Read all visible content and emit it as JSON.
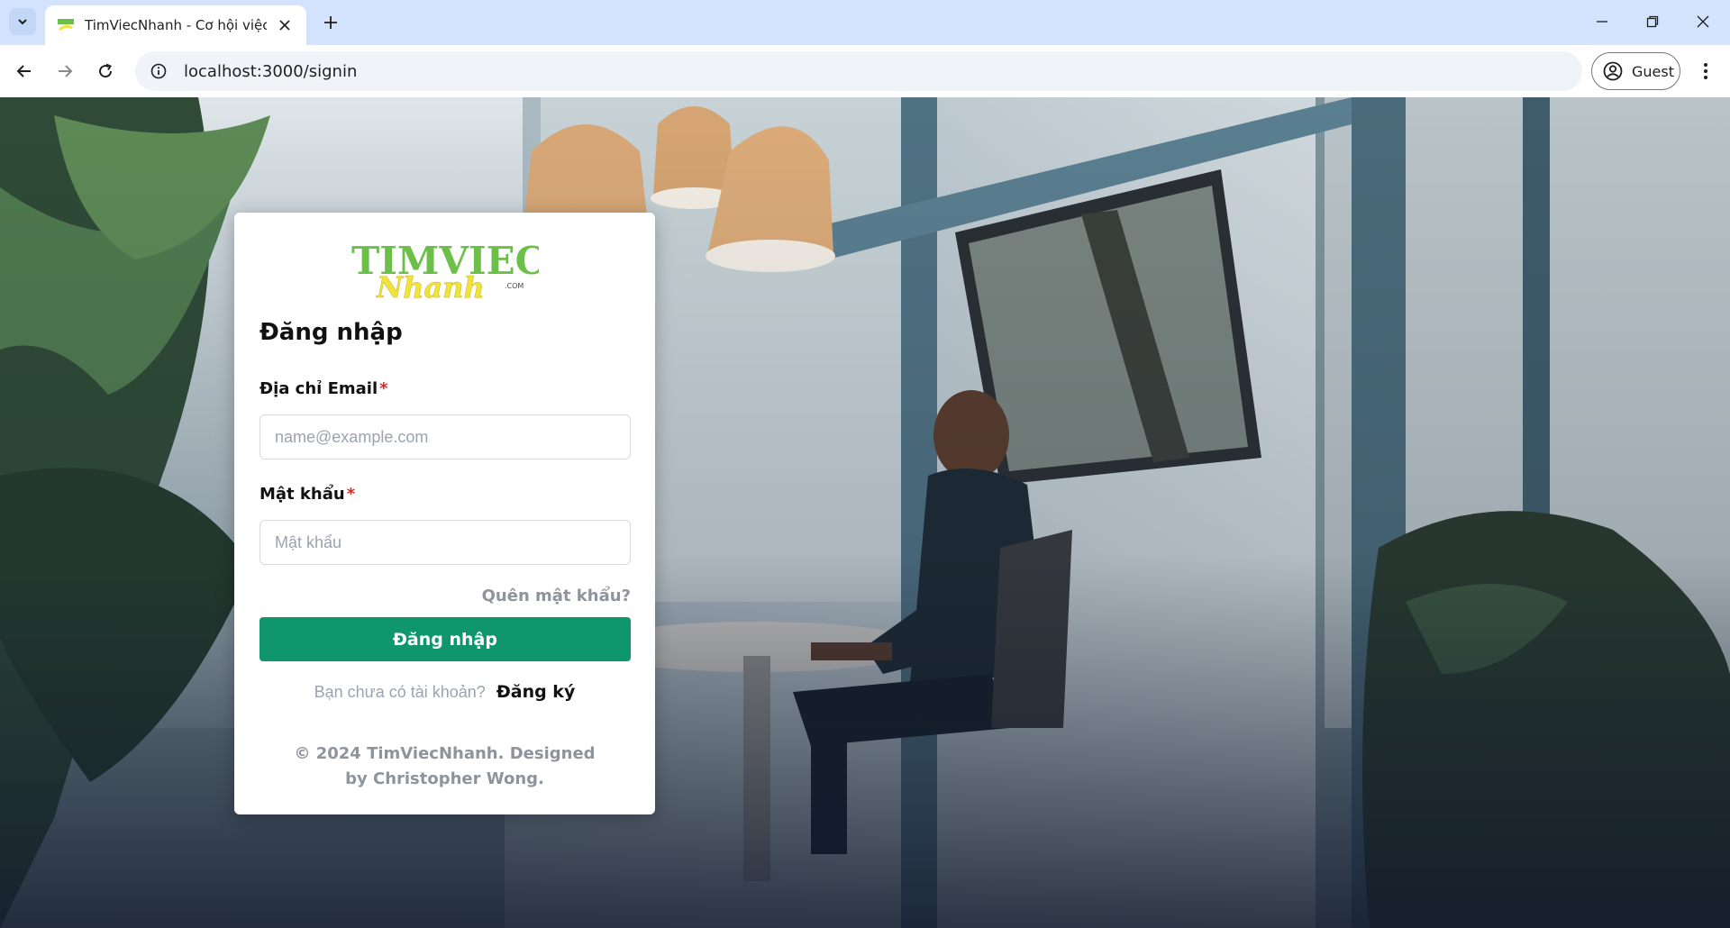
{
  "browser": {
    "tab_title": "TimViecNhanh - Cơ hội việc làm",
    "url": "localhost:3000/signin",
    "profile_label": "Guest"
  },
  "logo": {
    "word_top": "TIMVIEC",
    "word_script": "Nhanh",
    "suffix": ".COM",
    "colors": {
      "green": "#6cc04a",
      "yellow": "#f2e33b"
    }
  },
  "signin": {
    "heading": "Đăng nhập",
    "email_label": "Địa chỉ Email",
    "email_placeholder": "name@example.com",
    "password_label": "Mật khẩu",
    "password_placeholder": "Mật khẩu",
    "required_mark": "*",
    "forgot_link": "Quên mật khẩu?",
    "submit_label": "Đăng nhập",
    "signup_prompt": "Bạn chưa có tài khoản?",
    "signup_link": "Đăng ký",
    "footer": "© 2024 TimViecNhanh. Designed by Christopher Wong."
  },
  "colors": {
    "primary": "#0f976b",
    "required": "#e02424",
    "tabbar": "#d3e3fd"
  }
}
